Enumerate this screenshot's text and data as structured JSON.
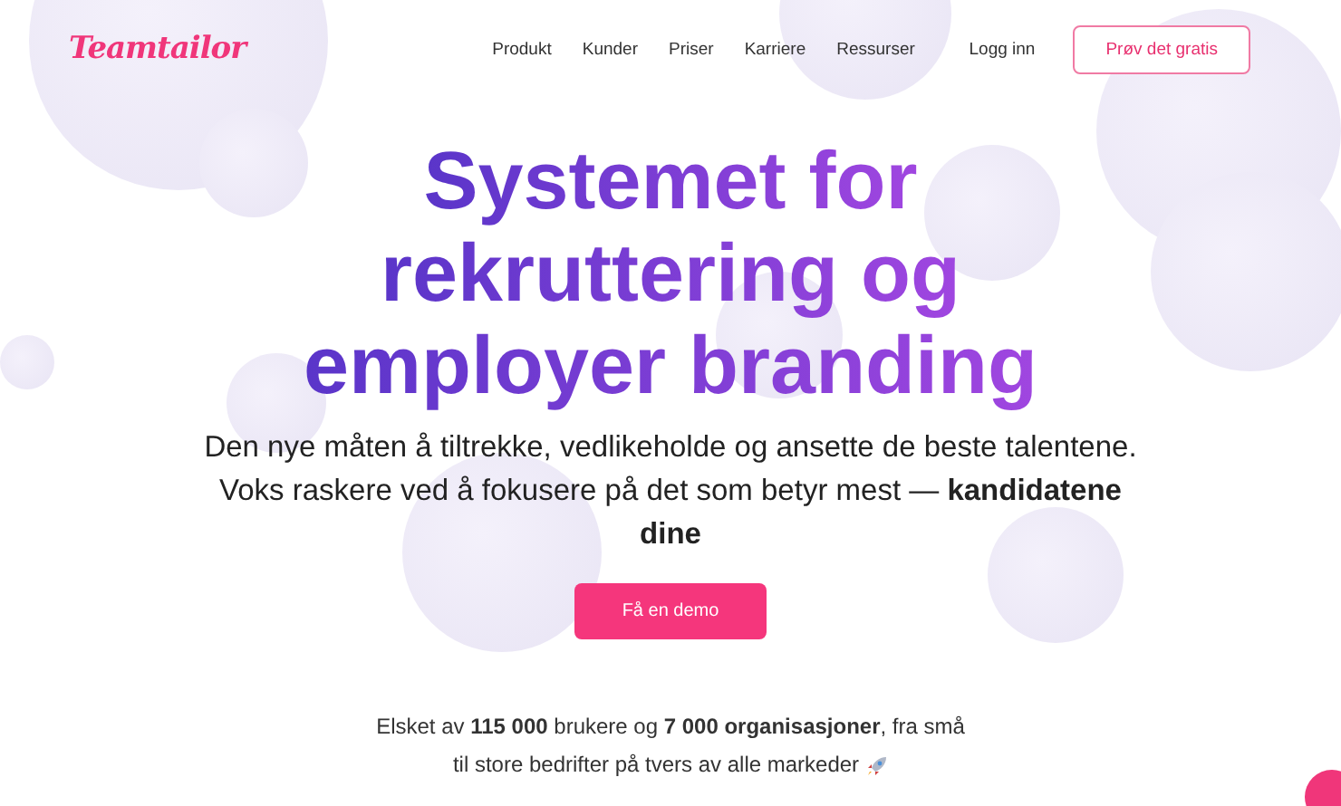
{
  "header": {
    "logo": "Teamtailor",
    "nav": [
      "Produkt",
      "Kunder",
      "Priser",
      "Karriere",
      "Ressurser"
    ],
    "login": "Logg inn",
    "cta": "Prøv det gratis"
  },
  "hero": {
    "title_lines": [
      "Systemet for",
      "rekruttering og",
      "employer branding"
    ],
    "subtitle": [
      "Den nye måten å tiltrekke, vedlikeholde og ansette de beste talentene.",
      "Voks raskere ved å fokusere på det som betyr mest — **kandidatene dine**"
    ],
    "button": "Få en demo"
  },
  "social_proof": [
    "Elsket av **115 000** brukere og **7 000 organisasjoner**, fra små",
    "til store bedrifter på tvers av alle markeder"
  ]
}
